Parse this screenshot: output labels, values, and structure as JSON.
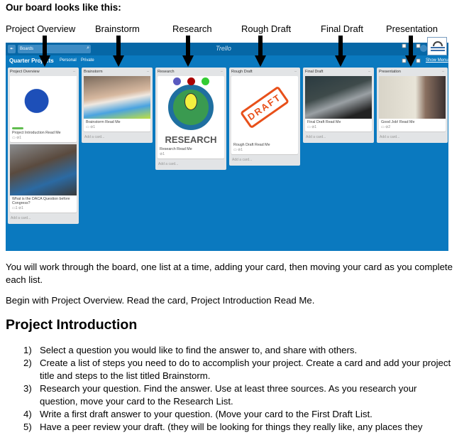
{
  "intro": "Our board looks like this:",
  "column_labels": [
    "Project Overview",
    "Brainstorm",
    "Research",
    "Rough Draft",
    "Final Draft",
    "Presentation"
  ],
  "board": {
    "boards_button": "Boards",
    "logo": "Trello",
    "title": "Quarter Projects",
    "personal": "Personal",
    "private": "Private",
    "show_menu": "Show Menu",
    "add_card": "Add a card...",
    "lists": [
      {
        "name": "Project Overview",
        "cards": [
          {
            "title": "Project Introduction Read Me",
            "badges": "▭  ⊘1"
          },
          {
            "title": "What is the DACA Question before Congress?",
            "badges": "▭1  ⊘1"
          }
        ]
      },
      {
        "name": "Brainstorm",
        "cards": [
          {
            "title": "Brainstorm Read Me",
            "badges": "▭  ⊘1"
          }
        ]
      },
      {
        "name": "Research",
        "cards": [
          {
            "title": "Research Read Me",
            "badges": "⊘1",
            "image_text": "RESEARCH"
          }
        ]
      },
      {
        "name": "Rough Draft",
        "cards": [
          {
            "title": "Rough Draft Read Me",
            "badges": "▭  ⊘1",
            "image_text": "DRAFT"
          }
        ]
      },
      {
        "name": "Final Draft",
        "cards": [
          {
            "title": "Final Draft Read Me",
            "badges": "▭  ⊘1"
          }
        ]
      },
      {
        "name": "Presentation",
        "cards": [
          {
            "title": "Good Job! Read Me",
            "badges": "▭  ⊘2"
          }
        ]
      }
    ]
  },
  "para1": "You will work through the board, one list at a time, adding your card, then moving your card as you complete each list.",
  "para2": "Begin with Project Overview. Read the card, Project Introduction Read Me.",
  "heading": "Project Introduction",
  "steps": [
    {
      "n": "1)",
      "text": "Select a question you would like to find the answer to, and share with others."
    },
    {
      "n": "2)",
      "text": "Create a list of steps you need to do to accomplish your project. Create a card and add your project title and steps to the list titled Brainstorm."
    },
    {
      "n": "3)",
      "text": "Research your question. Find the answer. Use at least three sources. As you research your question, move your card to the Research List."
    },
    {
      "n": "4)",
      "text": "Write a first draft answer to your question. (Move your card to the First Draft List."
    },
    {
      "n": "5)",
      "text": "Have a peer review your draft. (they will be looking for things they really like, any places they"
    }
  ]
}
